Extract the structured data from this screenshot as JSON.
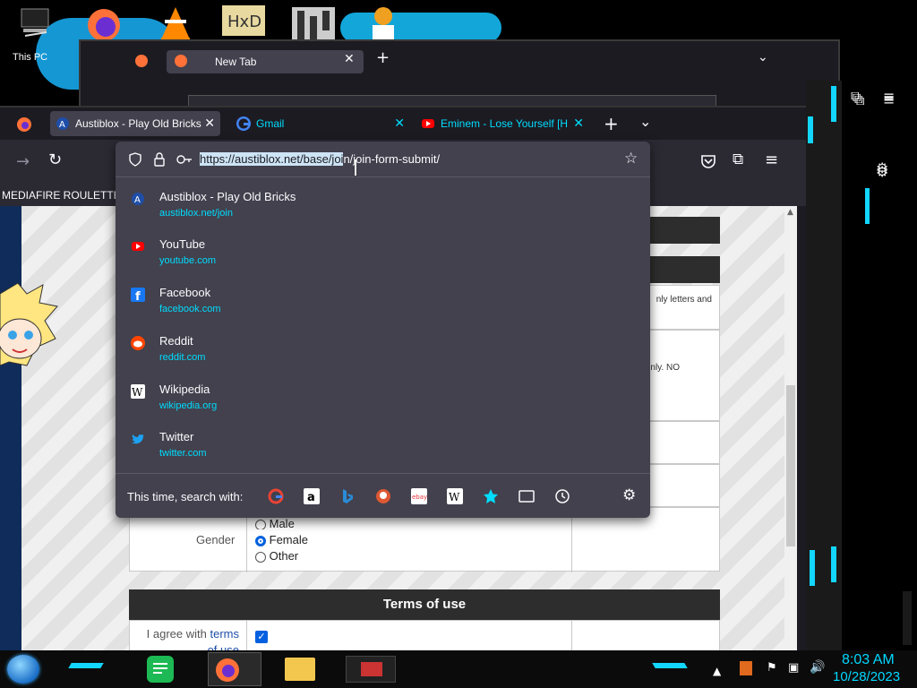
{
  "desktop": {
    "this_pc_label": "This PC"
  },
  "bg_window": {
    "tab_title": "New Tab"
  },
  "tabs": [
    {
      "title": "Austiblox - Play Old Bricks",
      "active": true
    },
    {
      "title": "Gmail",
      "active": false
    },
    {
      "title": "Eminem - Lose Yourself [H",
      "active": false
    }
  ],
  "bookmarks": {
    "item": "MEDIAFIRE ROULETTER"
  },
  "urlbar": {
    "url_selected": "https://austiblox.net/base/joi",
    "url_rest": "n/join-form-submit/"
  },
  "suggestions": [
    {
      "title": "Austiblox - Play Old Bricks",
      "url": "austiblox.net/join",
      "icon": "austiblox-icon"
    },
    {
      "title": "YouTube",
      "url": "youtube.com",
      "icon": "youtube-icon"
    },
    {
      "title": "Facebook",
      "url": "facebook.com",
      "icon": "facebook-icon"
    },
    {
      "title": "Reddit",
      "url": "reddit.com",
      "icon": "reddit-icon"
    },
    {
      "title": "Wikipedia",
      "url": "wikipedia.org",
      "icon": "wikipedia-icon"
    },
    {
      "title": "Twitter",
      "url": "twitter.com",
      "icon": "twitter-icon"
    }
  ],
  "search_with": {
    "label": "This time, search with:"
  },
  "form": {
    "text1": "nly letters and",
    "text2": "nly. NO",
    "gender_label": "Gender",
    "gender_options": [
      "Male",
      "Female",
      "Other"
    ],
    "gender_selected": "Female",
    "terms_header": "Terms of use",
    "agree_text": "I agree with",
    "terms_link": "terms",
    "of_use": "of use"
  },
  "taskbar": {
    "time": "8:03 AM",
    "date": "10/28/2023"
  },
  "colors": {
    "accent_cyan": "#00ddff",
    "url_highlight": "#cde4f5",
    "panel_bg": "#42414d",
    "toolbar_bg": "#2b2a33"
  }
}
